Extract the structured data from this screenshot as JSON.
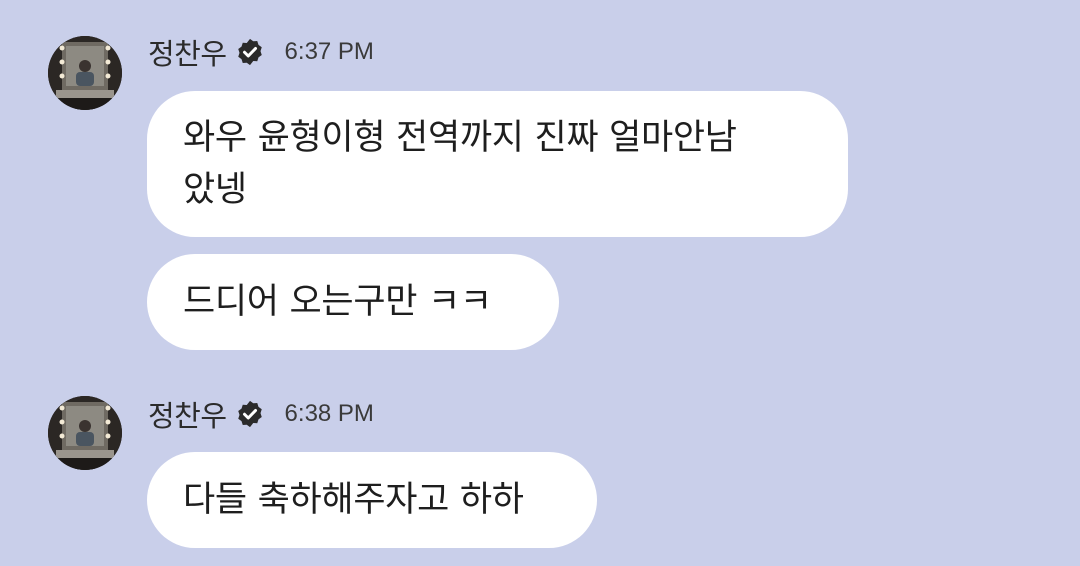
{
  "groups": [
    {
      "sender": "정찬우",
      "time": "6:37 PM",
      "avatar": "avatar-photo",
      "verified_icon": "verified-badge-icon",
      "messages": [
        {
          "line1": "와우 윤형이형 전역까지 진짜 얼마안남",
          "line2": "았넹"
        },
        {
          "line1": "드디어 오는구만 ㅋㅋ"
        }
      ]
    },
    {
      "sender": "정찬우",
      "time": "6:38 PM",
      "avatar": "avatar-photo",
      "verified_icon": "verified-badge-icon",
      "messages": [
        {
          "line1": "다들 축하해주자고 하하"
        }
      ]
    }
  ],
  "colors": {
    "background": "#c9cfea",
    "bubble": "#ffffff",
    "text": "#1e1e1e",
    "verified": "#2b2b2b"
  }
}
